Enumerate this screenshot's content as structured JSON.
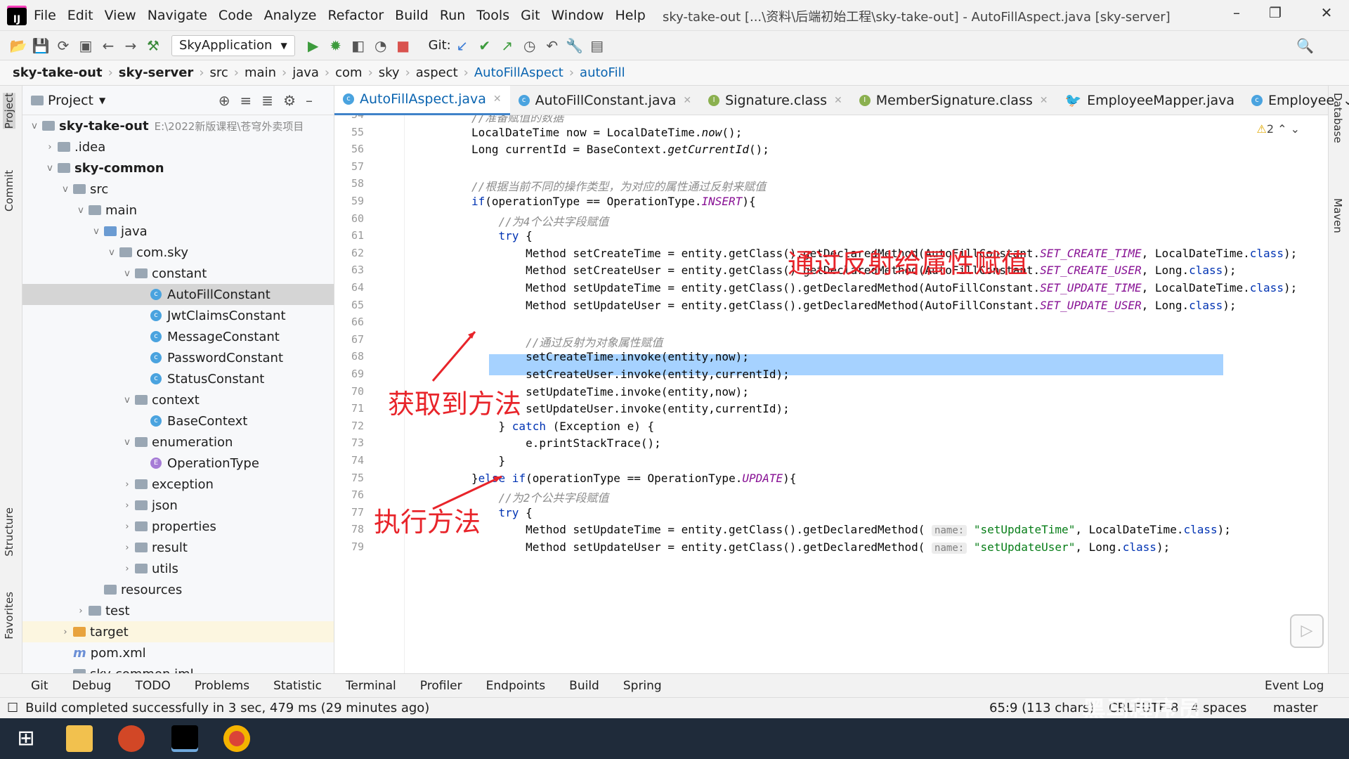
{
  "menu": [
    "File",
    "Edit",
    "View",
    "Navigate",
    "Code",
    "Analyze",
    "Refactor",
    "Build",
    "Run",
    "Tools",
    "Git",
    "Window",
    "Help"
  ],
  "window_title": "sky-take-out [...\\资料\\后端初始工程\\sky-take-out] - AutoFillAspect.java [sky-server]",
  "run_config": "SkyApplication",
  "git_label": "Git:",
  "breadcrumb": [
    "sky-take-out",
    "sky-server",
    "src",
    "main",
    "java",
    "com",
    "sky",
    "aspect",
    "AutoFillAspect",
    "autoFill"
  ],
  "left_tabs": [
    "Project",
    "Commit",
    "Structure",
    "Favorites"
  ],
  "right_tabs": [
    "Database",
    "Maven"
  ],
  "project": {
    "title": "Project",
    "root": "sky-take-out",
    "root_path": "E:\\2022新版课程\\苍穹外卖项目",
    "tree": [
      {
        "label": ".idea",
        "indent": 1,
        "arrow": ">",
        "icon": "folder"
      },
      {
        "label": "sky-common",
        "indent": 1,
        "arrow": "v",
        "icon": "folder"
      },
      {
        "label": "src",
        "indent": 2,
        "arrow": "v",
        "icon": "folder"
      },
      {
        "label": "main",
        "indent": 3,
        "arrow": "v",
        "icon": "folder"
      },
      {
        "label": "java",
        "indent": 4,
        "arrow": "v",
        "icon": "folder-blue"
      },
      {
        "label": "com.sky",
        "indent": 5,
        "arrow": "v",
        "icon": "folder"
      },
      {
        "label": "constant",
        "indent": 6,
        "arrow": "v",
        "icon": "folder"
      },
      {
        "label": "AutoFillConstant",
        "indent": 7,
        "arrow": "",
        "icon": "class",
        "selected": true
      },
      {
        "label": "JwtClaimsConstant",
        "indent": 7,
        "arrow": "",
        "icon": "class"
      },
      {
        "label": "MessageConstant",
        "indent": 7,
        "arrow": "",
        "icon": "class"
      },
      {
        "label": "PasswordConstant",
        "indent": 7,
        "arrow": "",
        "icon": "class"
      },
      {
        "label": "StatusConstant",
        "indent": 7,
        "arrow": "",
        "icon": "class"
      },
      {
        "label": "context",
        "indent": 6,
        "arrow": "v",
        "icon": "folder"
      },
      {
        "label": "BaseContext",
        "indent": 7,
        "arrow": "",
        "icon": "class"
      },
      {
        "label": "enumeration",
        "indent": 6,
        "arrow": "v",
        "icon": "folder"
      },
      {
        "label": "OperationType",
        "indent": 7,
        "arrow": "",
        "icon": "enum"
      },
      {
        "label": "exception",
        "indent": 6,
        "arrow": ">",
        "icon": "folder"
      },
      {
        "label": "json",
        "indent": 6,
        "arrow": ">",
        "icon": "folder"
      },
      {
        "label": "properties",
        "indent": 6,
        "arrow": ">",
        "icon": "folder"
      },
      {
        "label": "result",
        "indent": 6,
        "arrow": ">",
        "icon": "folder"
      },
      {
        "label": "utils",
        "indent": 6,
        "arrow": ">",
        "icon": "folder"
      },
      {
        "label": "resources",
        "indent": 4,
        "arrow": "",
        "icon": "folder"
      },
      {
        "label": "test",
        "indent": 3,
        "arrow": ">",
        "icon": "folder"
      },
      {
        "label": "target",
        "indent": 2,
        "arrow": ">",
        "icon": "folder-orange"
      },
      {
        "label": "pom.xml",
        "indent": 2,
        "arrow": "",
        "icon": "maven"
      },
      {
        "label": "sky-common.iml",
        "indent": 2,
        "arrow": "",
        "icon": "file"
      }
    ]
  },
  "tabs": [
    {
      "label": "AutoFillAspect.java",
      "active": true,
      "icon": "class"
    },
    {
      "label": "AutoFillConstant.java",
      "icon": "class"
    },
    {
      "label": "Signature.class",
      "icon": "interface"
    },
    {
      "label": "MemberSignature.class",
      "icon": "interface"
    },
    {
      "label": "EmployeeMapper.java",
      "icon": "mapper"
    },
    {
      "label": "Employee",
      "icon": "class"
    }
  ],
  "warnings": "2",
  "annotations": {
    "reflect": "通过反射给属性赋值",
    "get_method": "获取到方法",
    "invoke": "执行方法"
  },
  "code": [
    {
      "n": "54",
      "html": "<span class='cm'>//准备赋值的数据</span>"
    },
    {
      "n": "55",
      "html": "LocalDateTime now = LocalDateTime.<i>now</i>();"
    },
    {
      "n": "56",
      "html": "Long currentId = BaseContext.<i>getCurrentId</i>();"
    },
    {
      "n": "57",
      "html": ""
    },
    {
      "n": "58",
      "html": "<span class='cm'>//根据当前不同的操作类型，为对应的属性通过反射来赋值</span>"
    },
    {
      "n": "59",
      "html": "<span class='kw'>if</span>(operationType == OperationType.<span class='cst'>INSERT</span>){"
    },
    {
      "n": "60",
      "html": "    <span class='cm'>//为4个公共字段赋值</span>"
    },
    {
      "n": "61",
      "html": "    <span class='kw'>try</span> {"
    },
    {
      "n": "62",
      "html": "        Method setCreateTime = entity.getClass().getDeclaredMethod(AutoFillConstant.<span class='cst'>SET_CREATE_TIME</span>, LocalDateTime.<span class='kw'>class</span>);"
    },
    {
      "n": "63",
      "html": "        Method setCreateUser = entity.getClass().getDeclaredMethod(AutoFillConstant.<span class='cst'>SET_CREATE_USER</span>, Long.<span class='kw'>class</span>);"
    },
    {
      "n": "64",
      "html": "        Method setUpdateTime = entity.getClass().getDeclaredMethod(AutoFillConstant.<span class='cst'>SET_UPDATE_TIME</span>, LocalDateTime.<span class='kw'>class</span>);"
    },
    {
      "n": "65",
      "html": "        Method setUpdateUser = entity.getClass().getDeclaredMethod(AutoFillConstant.<span class='cst'>SET_UPDATE_USER</span>, Long.<span class='kw'>class</span>);"
    },
    {
      "n": "66",
      "html": ""
    },
    {
      "n": "67",
      "html": "        <span class='cm'>//通过反射为对象属性赋值</span>"
    },
    {
      "n": "68",
      "html": "        setCreateTime.invoke(entity,now);"
    },
    {
      "n": "69",
      "html": "        setCreateUser.invoke(entity,currentId);"
    },
    {
      "n": "70",
      "html": "        setUpdateTime.invoke(entity,now);"
    },
    {
      "n": "71",
      "html": "        setUpdateUser.invoke(entity,currentId);"
    },
    {
      "n": "72",
      "html": "    } <span class='kw'>catch</span> (Exception e) {"
    },
    {
      "n": "73",
      "html": "        e.printStackTrace();"
    },
    {
      "n": "74",
      "html": "    }"
    },
    {
      "n": "75",
      "html": "}<span class='kw'>else if</span>(operationType == OperationType.<span class='cst'>UPDATE</span>){"
    },
    {
      "n": "76",
      "html": "    <span class='cm'>//为2个公共字段赋值</span>"
    },
    {
      "n": "77",
      "html": "    <span class='kw'>try</span> {"
    },
    {
      "n": "78",
      "html": "        Method setUpdateTime = entity.getClass().getDeclaredMethod( <span class='hint'>name:</span> <span class='str'>\"setUpdateTime\"</span>, LocalDateTime.<span class='kw'>class</span>);"
    },
    {
      "n": "79",
      "html": "        Method setUpdateUser = entity.getClass().getDeclaredMethod( <span class='hint'>name:</span> <span class='str'>\"setUpdateUser\"</span>, Long.<span class='kw'>class</span>);"
    }
  ],
  "toolwindows": [
    "Git",
    "Debug",
    "TODO",
    "Problems",
    "Statistic",
    "Terminal",
    "Profiler",
    "Endpoints",
    "Build",
    "Spring"
  ],
  "event_log": "Event Log",
  "status": {
    "message": "Build completed successfully in 3 sec, 479 ms (29 minutes ago)",
    "position": "65:9 (113 chars)",
    "line_sep": "CRLF",
    "encoding": "UTF-8",
    "indent": "4 spaces",
    "branch": "master"
  },
  "watermark": "黑马程序员"
}
